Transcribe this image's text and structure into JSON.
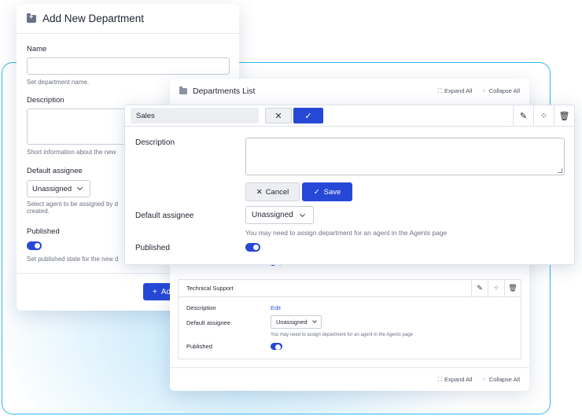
{
  "add_department": {
    "title": "Add New Department",
    "name_label": "Name",
    "name_help": "Set department name.",
    "description_label": "Description",
    "description_help": "Short information about the new",
    "assignee_label": "Default assignee",
    "assignee_value": "Unassigned",
    "assignee_help_line1": "Select agent to be assigned by d",
    "assignee_help_line2": "created.",
    "published_label": "Published",
    "published_on": true,
    "published_help": "Set published state for the new d",
    "add_button_label": "Ad"
  },
  "departments_list": {
    "title": "Departments List",
    "expand_all": "Expand All",
    "collapse_all": "Collapse All",
    "items": [
      {
        "name": "Technical Support",
        "description_label": "Description",
        "description_value": "Edit",
        "assignee_label": "Default assignee",
        "assignee_value": "Unassigned",
        "assignee_help": "You may need to assign department for an agent in the Agents page",
        "published_label": "Published",
        "published_on": true
      }
    ]
  },
  "sales_editor": {
    "name_value": "Sales",
    "description_label": "Description",
    "description_value": "",
    "cancel_label": "Cancel",
    "save_label": "Save",
    "assignee_label": "Default assignee",
    "assignee_value": "Unassigned",
    "assignee_help": "You may need to assign department for an agent in the Agents page",
    "published_label": "Published",
    "published_on": true
  },
  "colors": {
    "accent": "#2748d6",
    "frame": "#2fb6ea",
    "link": "#2e5bdc"
  }
}
